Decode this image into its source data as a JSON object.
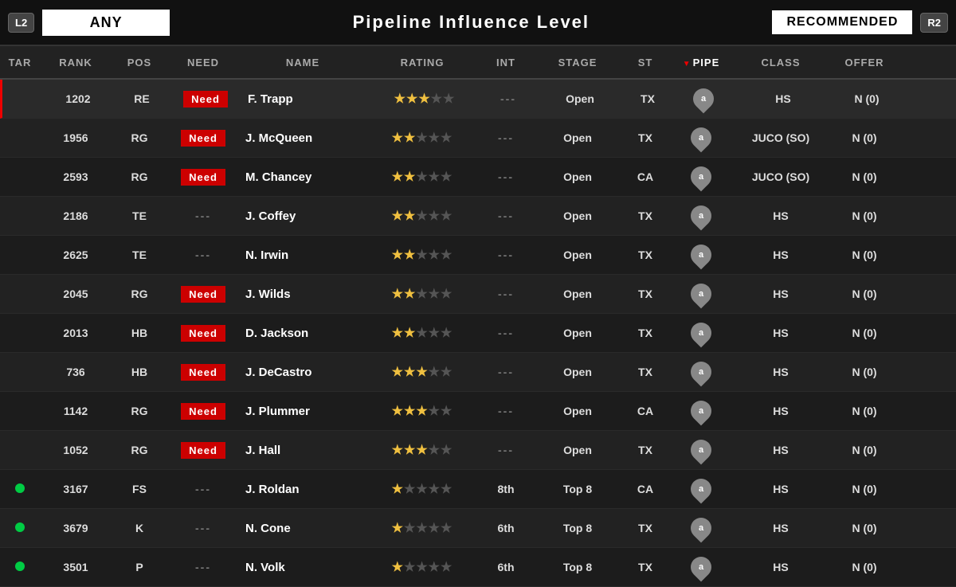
{
  "topBar": {
    "l2Label": "L2",
    "r2Label": "R2",
    "filterLabel": "ANY",
    "titleLabel": "Pipeline Influence Level",
    "recommendedLabel": "RECOMMENDED"
  },
  "columns": [
    {
      "key": "tar",
      "label": "TAR",
      "sorted": false
    },
    {
      "key": "rank",
      "label": "RANK",
      "sorted": false
    },
    {
      "key": "pos",
      "label": "POS",
      "sorted": false
    },
    {
      "key": "need",
      "label": "NEED",
      "sorted": false
    },
    {
      "key": "name",
      "label": "NAME",
      "sorted": false
    },
    {
      "key": "rating",
      "label": "RATING",
      "sorted": false
    },
    {
      "key": "int",
      "label": "INT",
      "sorted": false
    },
    {
      "key": "stage",
      "label": "STAGE",
      "sorted": false
    },
    {
      "key": "st",
      "label": "ST",
      "sorted": false
    },
    {
      "key": "pipe",
      "label": "PIPE",
      "sorted": true
    },
    {
      "key": "class",
      "label": "CLASS",
      "sorted": false
    },
    {
      "key": "offer",
      "label": "OFFER",
      "sorted": false
    }
  ],
  "rows": [
    {
      "tar": "",
      "rank": "1202",
      "pos": "RE",
      "need": true,
      "needLabel": "Need",
      "name": "F. Trapp",
      "stars": 3,
      "int": "---",
      "stage": "Open",
      "st": "TX",
      "pipe": true,
      "class": "HS",
      "offer": "N (0)",
      "dot": false,
      "highlight": true
    },
    {
      "tar": "",
      "rank": "1956",
      "pos": "RG",
      "need": true,
      "needLabel": "Need",
      "name": "J. McQueen",
      "stars": 2,
      "int": "---",
      "stage": "Open",
      "st": "TX",
      "pipe": true,
      "class": "JUCO (SO)",
      "offer": "N (0)",
      "dot": false,
      "highlight": false
    },
    {
      "tar": "",
      "rank": "2593",
      "pos": "RG",
      "need": true,
      "needLabel": "Need",
      "name": "M. Chancey",
      "stars": 2,
      "int": "---",
      "stage": "Open",
      "st": "CA",
      "pipe": true,
      "class": "JUCO (SO)",
      "offer": "N (0)",
      "dot": false,
      "highlight": false
    },
    {
      "tar": "",
      "rank": "2186",
      "pos": "TE",
      "need": false,
      "needLabel": "---",
      "name": "J. Coffey",
      "stars": 2,
      "int": "---",
      "stage": "Open",
      "st": "TX",
      "pipe": true,
      "class": "HS",
      "offer": "N (0)",
      "dot": false,
      "highlight": false
    },
    {
      "tar": "",
      "rank": "2625",
      "pos": "TE",
      "need": false,
      "needLabel": "---",
      "name": "N. Irwin",
      "stars": 2,
      "int": "---",
      "stage": "Open",
      "st": "TX",
      "pipe": true,
      "class": "HS",
      "offer": "N (0)",
      "dot": false,
      "highlight": false
    },
    {
      "tar": "",
      "rank": "2045",
      "pos": "RG",
      "need": true,
      "needLabel": "Need",
      "name": "J. Wilds",
      "stars": 2,
      "int": "---",
      "stage": "Open",
      "st": "TX",
      "pipe": true,
      "class": "HS",
      "offer": "N (0)",
      "dot": false,
      "highlight": false
    },
    {
      "tar": "",
      "rank": "2013",
      "pos": "HB",
      "need": true,
      "needLabel": "Need",
      "name": "D. Jackson",
      "stars": 2,
      "int": "---",
      "stage": "Open",
      "st": "TX",
      "pipe": true,
      "class": "HS",
      "offer": "N (0)",
      "dot": false,
      "highlight": false
    },
    {
      "tar": "",
      "rank": "736",
      "pos": "HB",
      "need": true,
      "needLabel": "Need",
      "name": "J. DeCastro",
      "stars": 3,
      "int": "---",
      "stage": "Open",
      "st": "TX",
      "pipe": true,
      "class": "HS",
      "offer": "N (0)",
      "dot": false,
      "highlight": false
    },
    {
      "tar": "",
      "rank": "1142",
      "pos": "RG",
      "need": true,
      "needLabel": "Need",
      "name": "J. Plummer",
      "stars": 3,
      "int": "---",
      "stage": "Open",
      "st": "CA",
      "pipe": true,
      "class": "HS",
      "offer": "N (0)",
      "dot": false,
      "highlight": false
    },
    {
      "tar": "",
      "rank": "1052",
      "pos": "RG",
      "need": true,
      "needLabel": "Need",
      "name": "J. Hall",
      "stars": 3,
      "int": "---",
      "stage": "Open",
      "st": "TX",
      "pipe": true,
      "class": "HS",
      "offer": "N (0)",
      "dot": false,
      "highlight": false
    },
    {
      "tar": "dot",
      "rank": "3167",
      "pos": "FS",
      "need": false,
      "needLabel": "---",
      "name": "J. Roldan",
      "stars": 1,
      "int": "8th",
      "stage": "Top 8",
      "st": "CA",
      "pipe": true,
      "class": "HS",
      "offer": "N (0)",
      "dot": true,
      "highlight": false
    },
    {
      "tar": "dot",
      "rank": "3679",
      "pos": "K",
      "need": false,
      "needLabel": "---",
      "name": "N. Cone",
      "stars": 1,
      "int": "6th",
      "stage": "Top 8",
      "st": "TX",
      "pipe": true,
      "class": "HS",
      "offer": "N (0)",
      "dot": true,
      "highlight": false
    },
    {
      "tar": "dot",
      "rank": "3501",
      "pos": "P",
      "need": false,
      "needLabel": "---",
      "name": "N. Volk",
      "stars": 1,
      "int": "6th",
      "stage": "Top 8",
      "st": "TX",
      "pipe": true,
      "class": "HS",
      "offer": "N (0)",
      "dot": true,
      "highlight": false
    }
  ],
  "colors": {
    "needBg": "#cc0000",
    "accent": "#e00000",
    "dotGreen": "#00cc44",
    "starFilled": "#f0c040",
    "starEmpty": "#555555"
  }
}
